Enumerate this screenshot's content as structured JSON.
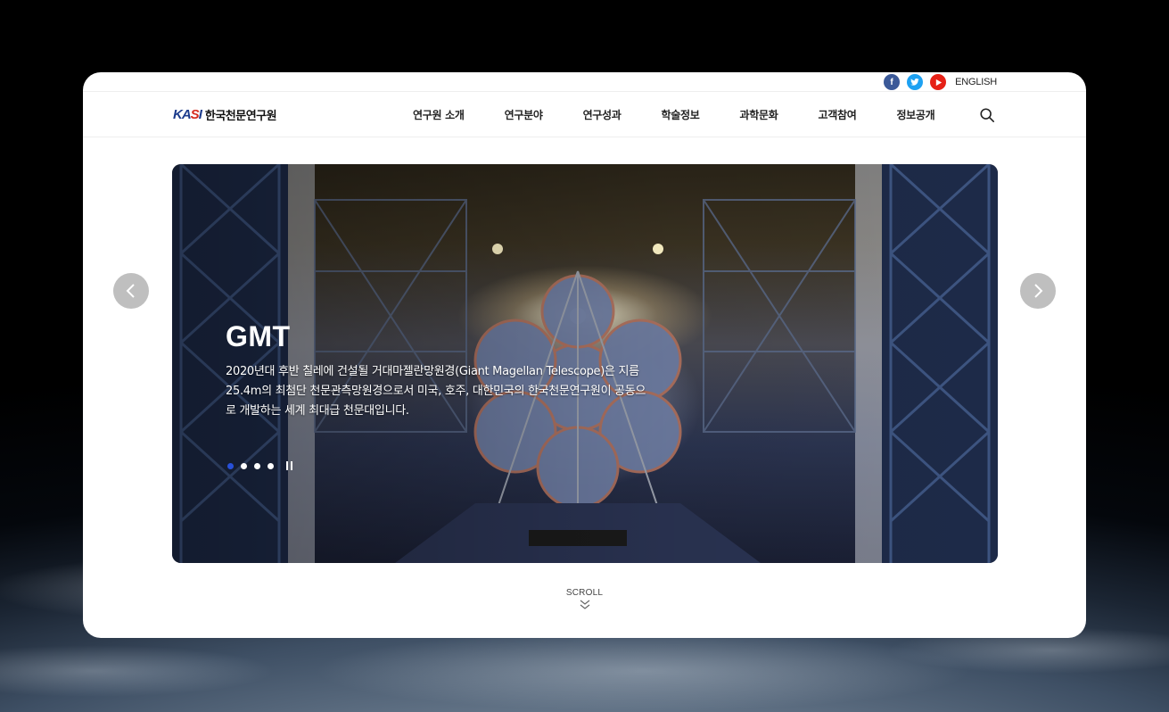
{
  "header": {
    "logo_mark": "KASI",
    "logo_text": "한국천문연구원",
    "language_label": "ENGLISH",
    "sns": [
      {
        "name": "facebook",
        "glyph": "f",
        "color": "#3b5998"
      },
      {
        "name": "twitter",
        "glyph": "t",
        "color": "#1da1f2"
      },
      {
        "name": "youtube",
        "glyph": "▶",
        "color": "#e62117"
      }
    ]
  },
  "nav": {
    "items": [
      "연구원 소개",
      "연구분야",
      "연구성과",
      "학술정보",
      "과학문화",
      "고객참여",
      "정보공개"
    ]
  },
  "hero": {
    "title": "GMT",
    "description": "2020년대 후반 칠레에 건설될 거대마젤란망원경(Giant Magellan Telescope)은 지름 25.4m의 최첨단 천문관측망원경으로서 미국, 호주, 대한민국의 한국천문연구원이 공동으로 개발하는 세계 최대급 천문대입니다.",
    "slide_count": 4,
    "active_slide": 1
  },
  "scroll": {
    "label": "SCROLL"
  },
  "colors": {
    "accent": "#2850d8",
    "logo_blue": "#1c3b8c",
    "logo_red": "#d52b1e"
  }
}
